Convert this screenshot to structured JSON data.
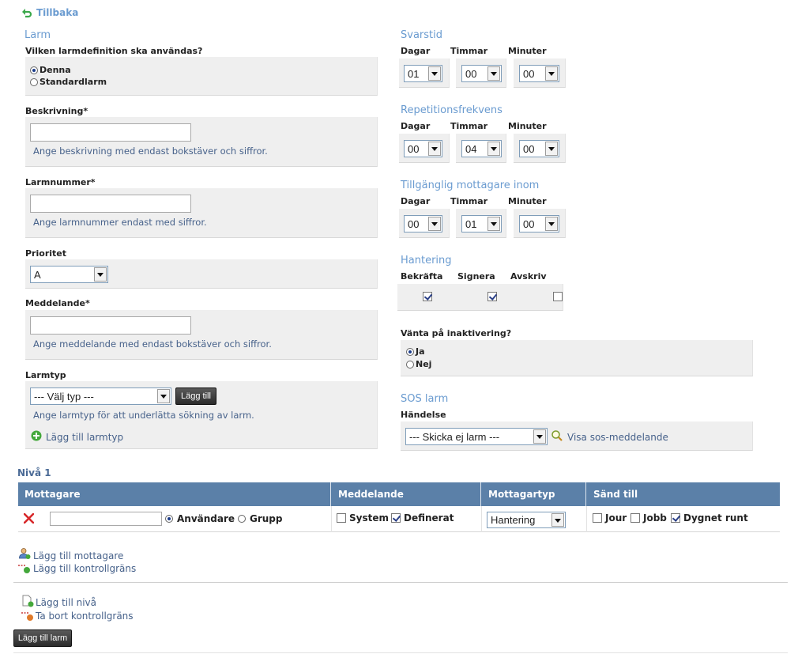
{
  "nav": {
    "back_label": "Tillbaka"
  },
  "larm": {
    "title": "Larm",
    "def_question": "Vilken larmdefinition ska användas?",
    "def_options": [
      "Denna",
      "Standardlarm"
    ],
    "beskrivning_label": "Beskrivning*",
    "beskrivning_value": "",
    "beskrivning_hint": "Ange beskrivning med endast bokstäver och siffror.",
    "larmnummer_label": "Larmnummer*",
    "larmnummer_value": "",
    "larmnummer_hint": "Ange larmnummer endast med siffror.",
    "prioritet_label": "Prioritet",
    "prioritet_value": "A",
    "meddelande_label": "Meddelande*",
    "meddelande_value": "",
    "meddelande_hint": "Ange meddelande med endast bokstäver och siffror.",
    "larmtyp_label": "Larmtyp",
    "larmtyp_value": "--- Välj typ ---",
    "larmtyp_add_button": "Lägg till",
    "larmtyp_hint": "Ange larmtyp för att underlätta sökning av larm.",
    "larmtyp_add_link": "Lägg till larmtyp"
  },
  "time_labels": {
    "dagar": "Dagar",
    "timmar": "Timmar",
    "minuter": "Minuter"
  },
  "svarstid": {
    "title": "Svarstid",
    "dagar": "01",
    "timmar": "00",
    "minuter": "00"
  },
  "repetition": {
    "title": "Repetitionsfrekvens",
    "dagar": "00",
    "timmar": "04",
    "minuter": "00"
  },
  "tillganglig": {
    "title": "Tillgänglig mottagare inom",
    "dagar": "00",
    "timmar": "01",
    "minuter": "00"
  },
  "hantering": {
    "title": "Hantering",
    "options": [
      {
        "label": "Bekräfta",
        "checked": true
      },
      {
        "label": "Signera",
        "checked": true
      },
      {
        "label": "Avskriv",
        "checked": false
      }
    ]
  },
  "vanta": {
    "question": "Vänta på inaktivering?",
    "options": [
      "Ja",
      "Nej"
    ],
    "selected": "Ja"
  },
  "sos": {
    "title": "SOS larm",
    "handelse_label": "Händelse",
    "handelse_value": "--- Skicka ej larm ---",
    "visa_link": "Visa sos-meddelande"
  },
  "niva": {
    "title": "Nivå 1",
    "headers": [
      "Mottagare",
      "Meddelande",
      "Mottagartyp",
      "Sänd till"
    ],
    "row": {
      "mottagare_value": "",
      "mottagare_options": [
        "Användare",
        "Grupp"
      ],
      "mottagare_selected": "Användare",
      "meddelande_options": [
        {
          "label": "System",
          "checked": false
        },
        {
          "label": "Definerat",
          "checked": true
        }
      ],
      "mottagartyp_value": "Hantering",
      "sand_till": [
        {
          "label": "Jour",
          "checked": false
        },
        {
          "label": "Jobb",
          "checked": false
        },
        {
          "label": "Dygnet runt",
          "checked": true
        }
      ]
    },
    "add_mottagare": "Lägg till mottagare",
    "add_kontrollgrans": "Lägg till kontrollgräns"
  },
  "footer": {
    "add_niva": "Lägg till nivå",
    "remove_kontrollgrans": "Ta bort kontrollgräns",
    "submit_button": "Lägg till larm"
  },
  "colors": {
    "section_title": "#6a9bd0",
    "table_header": "#5b80a8",
    "hint": "#46618a"
  }
}
